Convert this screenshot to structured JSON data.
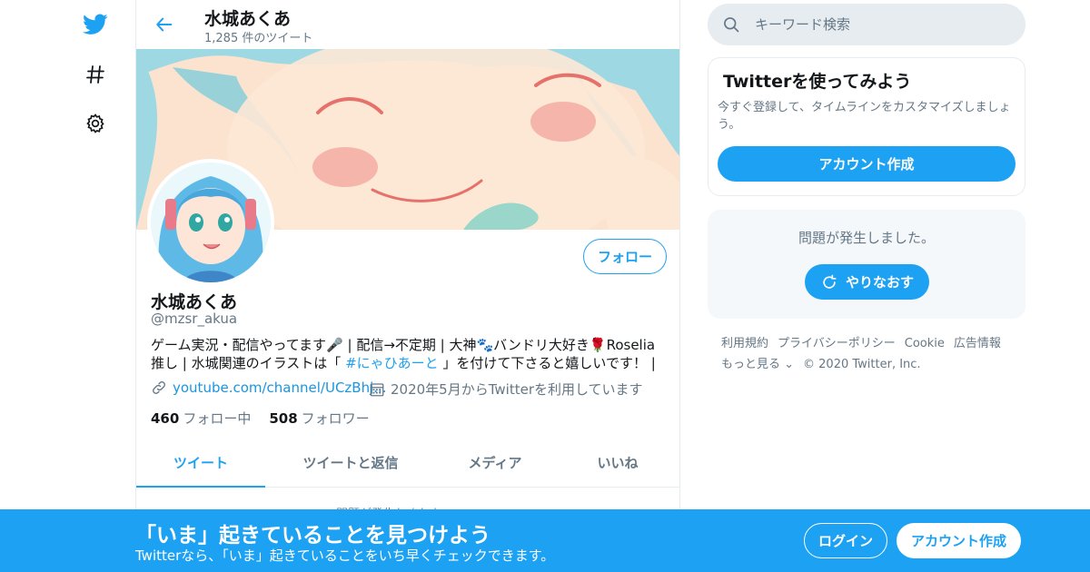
{
  "nav": {
    "icons": [
      "twitter-bird-icon",
      "hashtag-icon",
      "settings-gear-icon"
    ]
  },
  "header": {
    "name": "水城あくあ",
    "tweet_count": "1,285 件のツイート"
  },
  "profile": {
    "display_name": "水城あくあ",
    "handle": "@mzsr_akua",
    "bio_line1": "ゲーム実況・配信やってます🎤 | 配信→不定期 | 大神🐾バンドリ大好き🌹Roselia",
    "bio_line2_a": "推し | 水城関連のイラストは「 ",
    "bio_hashtag": "#にゃひあーと",
    "bio_line2_b": " 」を付けて下さると嬉しいです！ |",
    "website": "youtube.com/channel/UCzBhj...",
    "joined": "2020年5月からTwitterを利用しています",
    "following_count": "460",
    "following_label": "フォロー中",
    "followers_count": "508",
    "followers_label": "フォロワー",
    "follow_button": "フォロー"
  },
  "tabs": [
    {
      "label": "ツイート",
      "active": true
    },
    {
      "label": "ツイートと返信",
      "active": false
    },
    {
      "label": "メディア",
      "active": false
    },
    {
      "label": "いいね",
      "active": false
    }
  ],
  "below_tabs_partial": "問題が発生しました。",
  "search": {
    "placeholder": "キーワード検索"
  },
  "signup_card": {
    "title": "Twitterを使ってみよう",
    "text": "今すぐ登録して、タイムラインをカスタマイズしましょう。",
    "button": "アカウント作成"
  },
  "error_card": {
    "message": "問題が発生しました。",
    "retry": "やりなおす"
  },
  "footer": {
    "links": [
      "利用規約",
      "プライバシーポリシー",
      "Cookie",
      "広告情報"
    ],
    "more": "もっと見る ⌄",
    "copyright": "© 2020 Twitter, Inc."
  },
  "bottom_bar": {
    "title": "「いま」起きていることを見つけよう",
    "subtitle": "Twitterなら、「いま」起きていることをいち早くチェックできます。",
    "login": "ログイン",
    "signup": "アカウント作成"
  },
  "colors": {
    "accent": "#1da1f2",
    "text": "#14171a",
    "secondary": "#657786",
    "border": "#e6ecf0"
  }
}
